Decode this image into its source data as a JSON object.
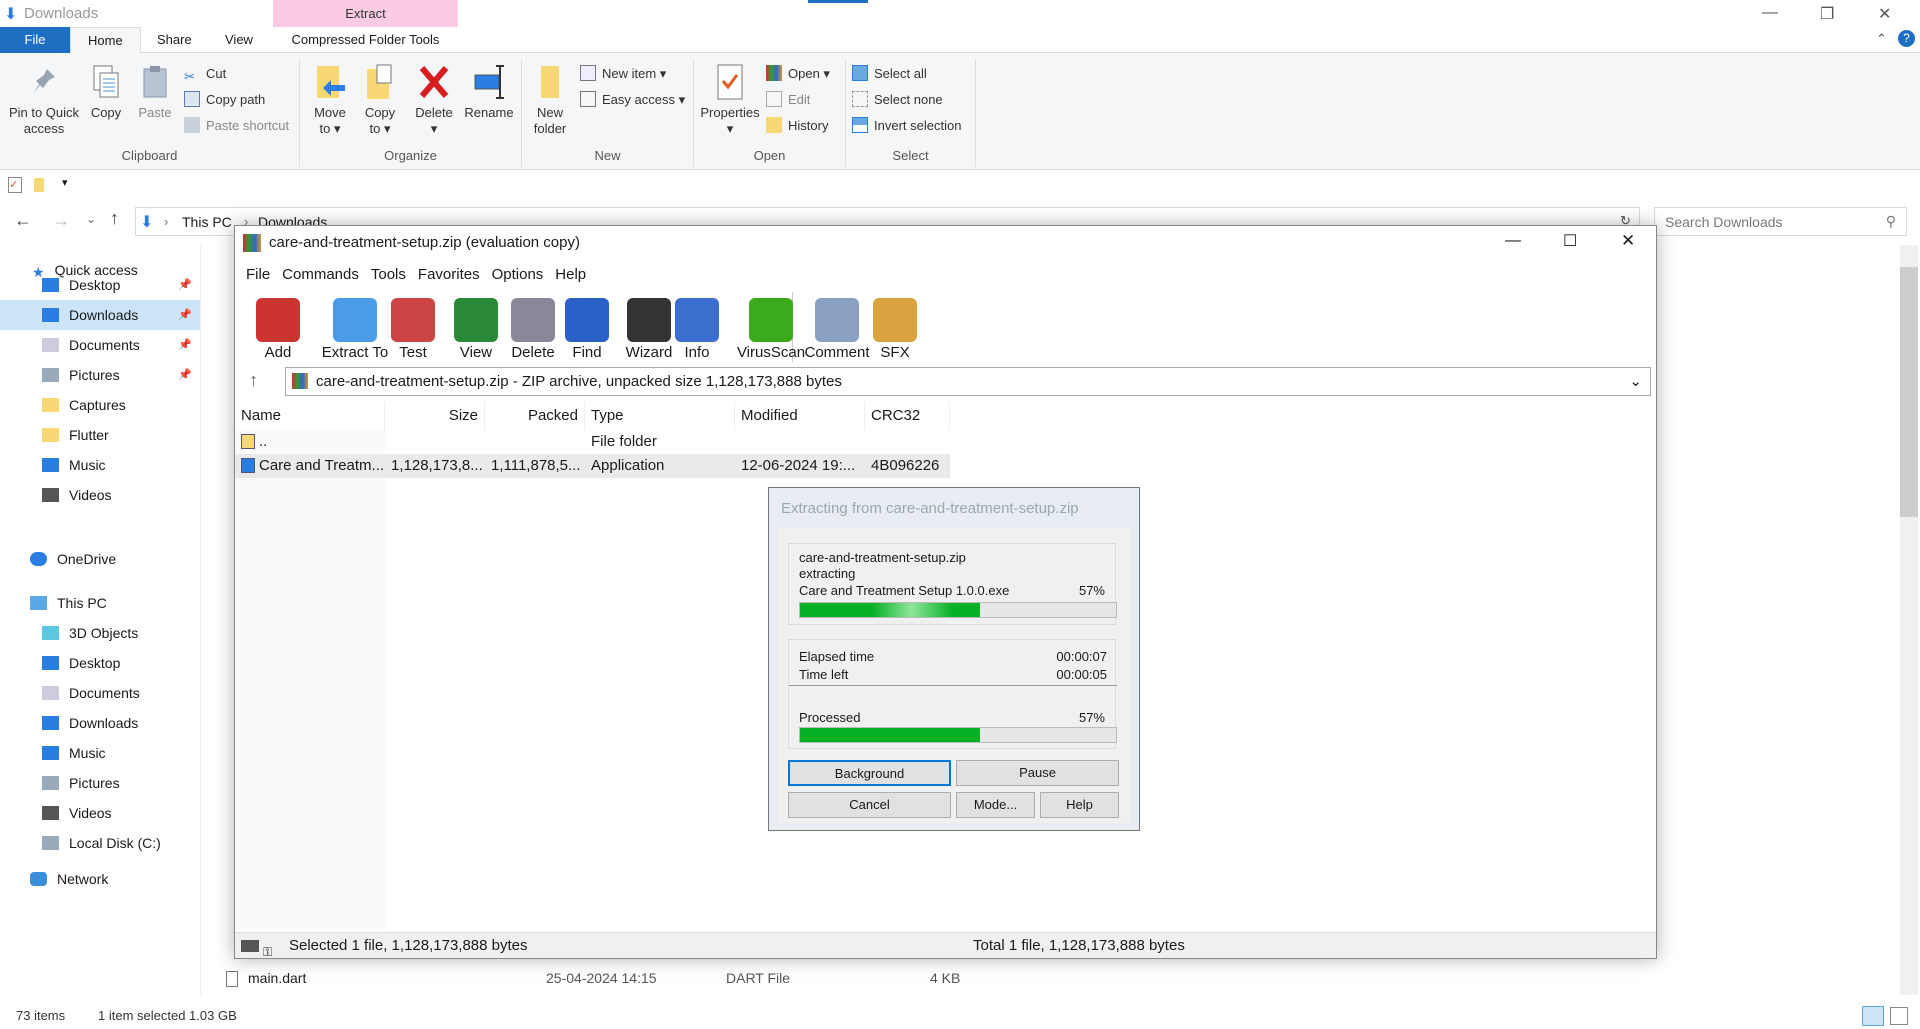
{
  "explorer": {
    "title": "Downloads",
    "contextual_tab_group": "Extract",
    "tabs": [
      "File",
      "Home",
      "Share",
      "View",
      "Compressed Folder Tools"
    ],
    "ribbon": {
      "clipboard": {
        "label": "Clipboard",
        "pin": "Pin to Quick access",
        "copy": "Copy",
        "paste": "Paste",
        "cut": "Cut",
        "copy_path": "Copy path",
        "paste_shortcut": "Paste shortcut"
      },
      "organize": {
        "label": "Organize",
        "move_to": "Move to",
        "copy_to": "Copy to",
        "delete": "Delete",
        "rename": "Rename"
      },
      "new": {
        "label": "New",
        "new_folder": "New folder",
        "new_item": "New item",
        "easy_access": "Easy access"
      },
      "open": {
        "label": "Open",
        "properties": "Properties",
        "open": "Open",
        "edit": "Edit",
        "history": "History"
      },
      "select": {
        "label": "Select",
        "select_all": "Select all",
        "select_none": "Select none",
        "invert": "Invert selection"
      }
    },
    "breadcrumb": [
      "This PC",
      "Downloads"
    ],
    "search_placeholder": "Search Downloads",
    "nav": {
      "quick_access": "Quick access",
      "quick_items": [
        "Desktop",
        "Downloads",
        "Documents",
        "Pictures",
        "Captures",
        "Flutter",
        "Music",
        "Videos"
      ],
      "onedrive": "OneDrive",
      "this_pc": "This PC",
      "pc_items": [
        "3D Objects",
        "Desktop",
        "Documents",
        "Downloads",
        "Music",
        "Pictures",
        "Videos",
        "Local Disk (C:)"
      ],
      "network": "Network"
    },
    "visible_file": {
      "name": "main.dart",
      "modified": "25-04-2024 14:15",
      "type": "DART File",
      "size": "4 KB"
    },
    "status": {
      "items": "73 items",
      "selected": "1 item selected  1.03 GB"
    }
  },
  "winrar": {
    "title": "care-and-treatment-setup.zip (evaluation copy)",
    "menu": [
      "File",
      "Commands",
      "Tools",
      "Favorites",
      "Options",
      "Help"
    ],
    "toolbar": [
      "Add",
      "Extract To",
      "Test",
      "View",
      "Delete",
      "Find",
      "Wizard",
      "Info",
      "VirusScan",
      "Comment",
      "SFX"
    ],
    "address": "care-and-treatment-setup.zip - ZIP archive, unpacked size 1,128,173,888 bytes",
    "columns": [
      "Name",
      "Size",
      "Packed",
      "Type",
      "Modified",
      "CRC32"
    ],
    "rows": [
      {
        "name": "..",
        "size": "",
        "packed": "",
        "type": "File folder",
        "modified": "",
        "crc": ""
      },
      {
        "name": "Care and Treatm...",
        "size": "1,128,173,8...",
        "packed": "1,111,878,5...",
        "type": "Application",
        "modified": "12-06-2024 19:...",
        "crc": "4B096226"
      }
    ],
    "status_left": "Selected 1 file, 1,128,173,888 bytes",
    "status_right": "Total 1 file, 1,128,173,888 bytes"
  },
  "dialog": {
    "title": "Extracting from care-and-treatment-setup.zip",
    "archive": "care-and-treatment-setup.zip",
    "action": "extracting",
    "file": "Care and Treatment Setup 1.0.0.exe",
    "file_percent": "57%",
    "file_progress": 57,
    "elapsed_label": "Elapsed time",
    "elapsed": "00:00:07",
    "left_label": "Time left",
    "left": "00:00:05",
    "processed_label": "Processed",
    "processed_percent": "57%",
    "processed_progress": 57,
    "buttons": [
      "Background",
      "Pause",
      "Cancel",
      "Mode...",
      "Help"
    ]
  },
  "colors": {
    "accent": "#1e6fc2",
    "progress": "#06b025",
    "contextual": "#fbcbe3"
  }
}
